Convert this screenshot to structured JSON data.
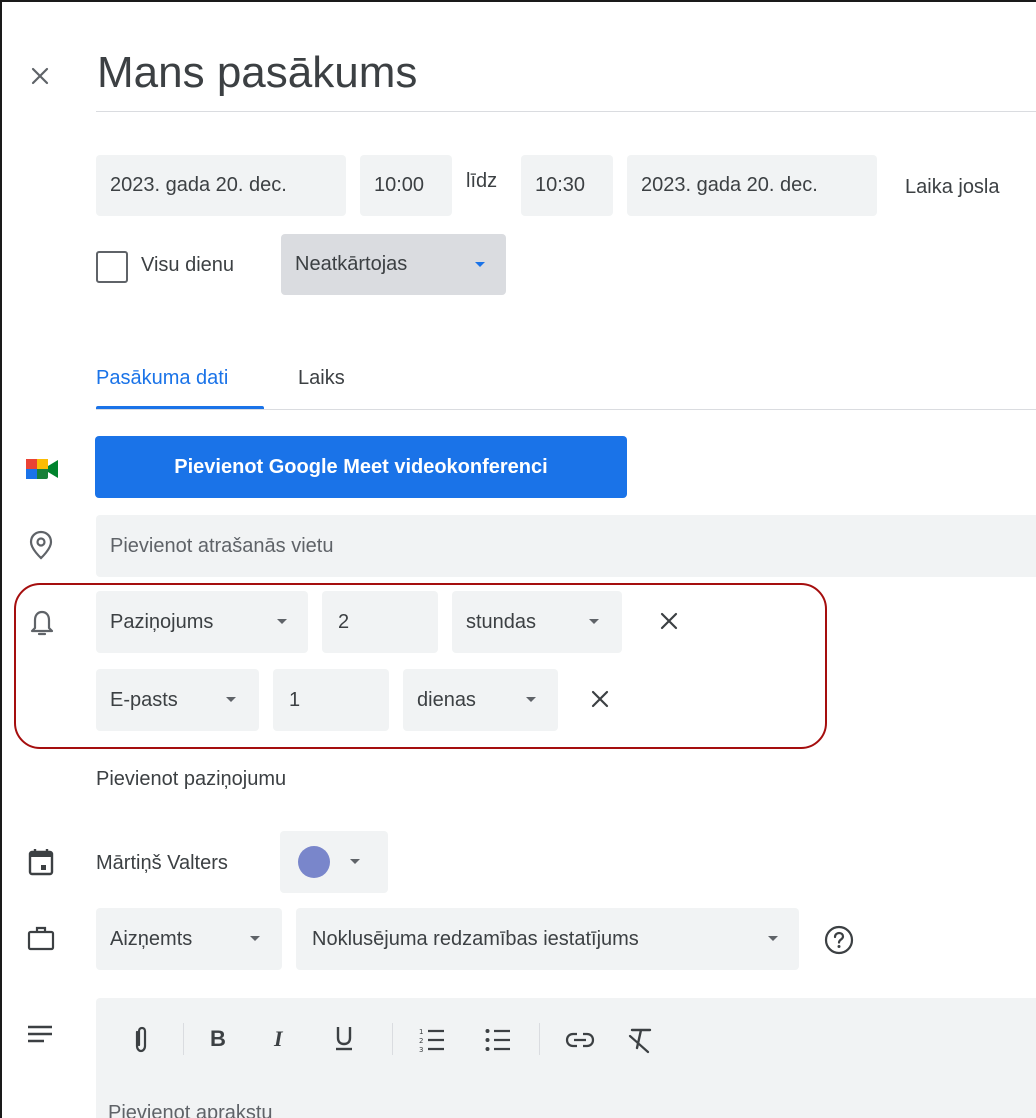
{
  "header": {
    "title": "Mans pasākums"
  },
  "datetime": {
    "start_date": "2023. gada 20. dec.",
    "start_time": "10:00",
    "to_label": "līdz",
    "end_time": "10:30",
    "end_date": "2023. gada 20. dec.",
    "timezone_label": "Laika josla"
  },
  "options": {
    "all_day_label": "Visu dienu",
    "all_day_checked": false,
    "repeat_value": "Neatkārtojas"
  },
  "tabs": [
    {
      "label": "Pasākuma dati",
      "active": true
    },
    {
      "label": "Laiks",
      "active": false
    }
  ],
  "meet": {
    "button_label": "Pievienot Google Meet videokonferenci"
  },
  "location": {
    "placeholder": "Pievienot atrašanās vietu"
  },
  "notifications": [
    {
      "type": "Paziņojums",
      "amount": "2",
      "unit": "stundas"
    },
    {
      "type": "E-pasts",
      "amount": "1",
      "unit": "dienas"
    }
  ],
  "add_notification_label": "Pievienot paziņojumu",
  "calendar": {
    "owner": "Mārtiņš Valters",
    "color": "#7986cb"
  },
  "availability": {
    "busy_value": "Aizņemts",
    "visibility_value": "Noklusējuma redzamības iestatījums"
  },
  "description": {
    "placeholder": "Pievienot aprakstu",
    "toolbar": [
      "attach-icon",
      "bold-icon",
      "italic-icon",
      "underline-icon",
      "numbered-list-icon",
      "bulleted-list-icon",
      "link-icon",
      "clear-formatting-icon"
    ]
  },
  "colors": {
    "accent": "#1a73e8",
    "highlight_border": "#a50e0e"
  }
}
